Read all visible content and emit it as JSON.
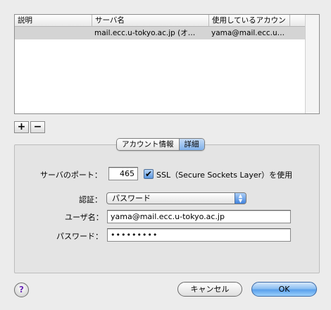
{
  "table": {
    "headers": [
      "説明",
      "サーバ名",
      "使用しているアカウン"
    ],
    "rows": [
      {
        "description": "",
        "server": "mail.ecc.u-tokyo.ac.jp (オ…",
        "account": "yama@mail.ecc.u…"
      }
    ]
  },
  "list_buttons": {
    "add": "+",
    "remove": "−"
  },
  "tabs": [
    {
      "label": "アカウント情報",
      "selected": false
    },
    {
      "label": "詳細",
      "selected": true
    }
  ],
  "form": {
    "port_label": "サーバのポート：",
    "port_value": "465",
    "ssl_checked": true,
    "ssl_label": "SSL（Secure Sockets Layer）を使用",
    "auth_label": "認証：",
    "auth_value": "パスワード",
    "username_label": "ユーザ名：",
    "username_value": "yama@mail.ecc.u-tokyo.ac.jp",
    "password_label": "パスワード：",
    "password_value": "•••••••••"
  },
  "buttons": {
    "help": "?",
    "cancel": "キャンセル",
    "ok": "OK"
  },
  "colors": {
    "selected_row": "#d4d4d4",
    "accent_blue": "#5aa0ec"
  }
}
